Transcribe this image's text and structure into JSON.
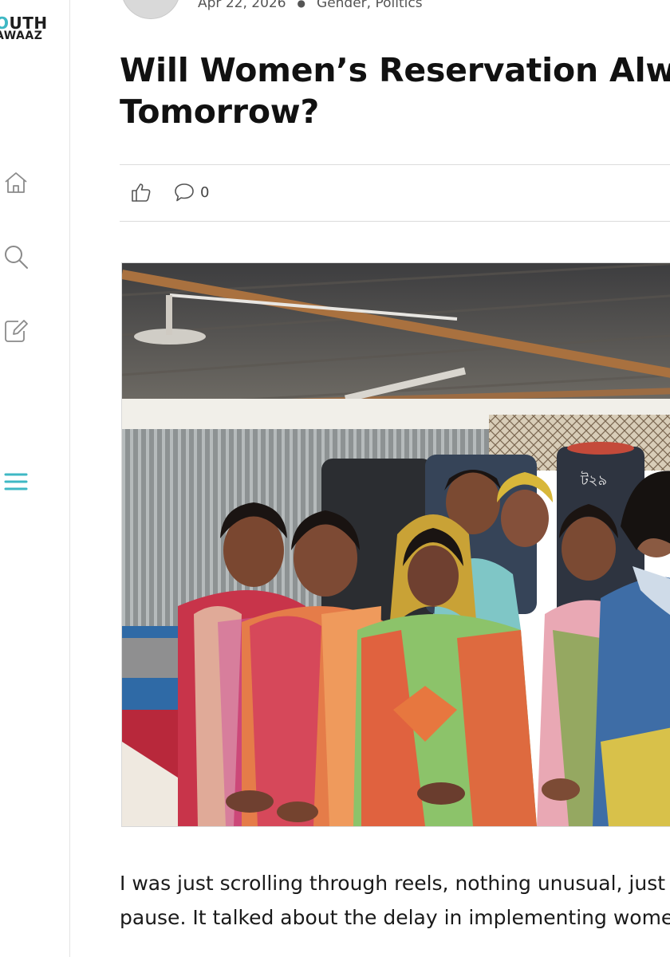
{
  "sidebar": {
    "logo_line1_a": "O",
    "logo_line1_b": "UTH",
    "logo_line2": "AWAAZ",
    "icons": [
      "home-icon",
      "search-icon",
      "edit-icon",
      "menu-icon"
    ],
    "accent_color": "#3fb8c4"
  },
  "post": {
    "date": "Apr 22, 2026",
    "categories": "Gender, Politics",
    "title_line1": "Will Women’s Reservation Alw",
    "title_line2": "Tomorrow?",
    "comment_count": "0",
    "hero_image_alt": "",
    "body_line1": "I was just scrolling through reels, nothing unusual, just",
    "body_line2": "pause. It talked about the delay in implementing wome"
  }
}
